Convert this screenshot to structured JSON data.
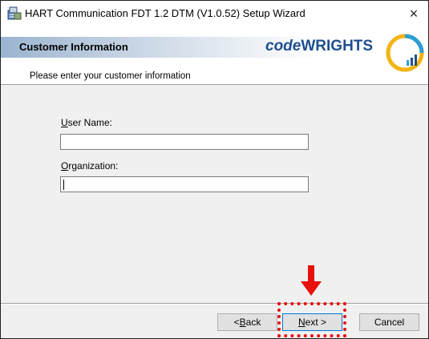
{
  "window": {
    "title": "HART Communication FDT 1.2 DTM (V1.0.52) Setup Wizard",
    "close_symbol": "×"
  },
  "banner": {
    "heading": "Customer Information",
    "brand_prefix": "code",
    "brand_suffix": "WRIGHTS",
    "logo_line1": "code",
    "logo_line2": "WRIGHTS",
    "subtitle": "Please enter your customer information"
  },
  "form": {
    "user_name": {
      "accel": "U",
      "label_rest": "ser Name:",
      "value": ""
    },
    "organization": {
      "accel": "O",
      "label_rest": "rganization:",
      "value": ""
    }
  },
  "buttons": {
    "back": {
      "prefix": "< ",
      "accel": "B",
      "rest": "ack"
    },
    "next": {
      "accel": "N",
      "rest": "ext >"
    },
    "cancel": {
      "label": "Cancel"
    }
  },
  "colors": {
    "annotation": "#e8100b",
    "brand": "#1f4f8f",
    "focus": "#0078d7"
  }
}
